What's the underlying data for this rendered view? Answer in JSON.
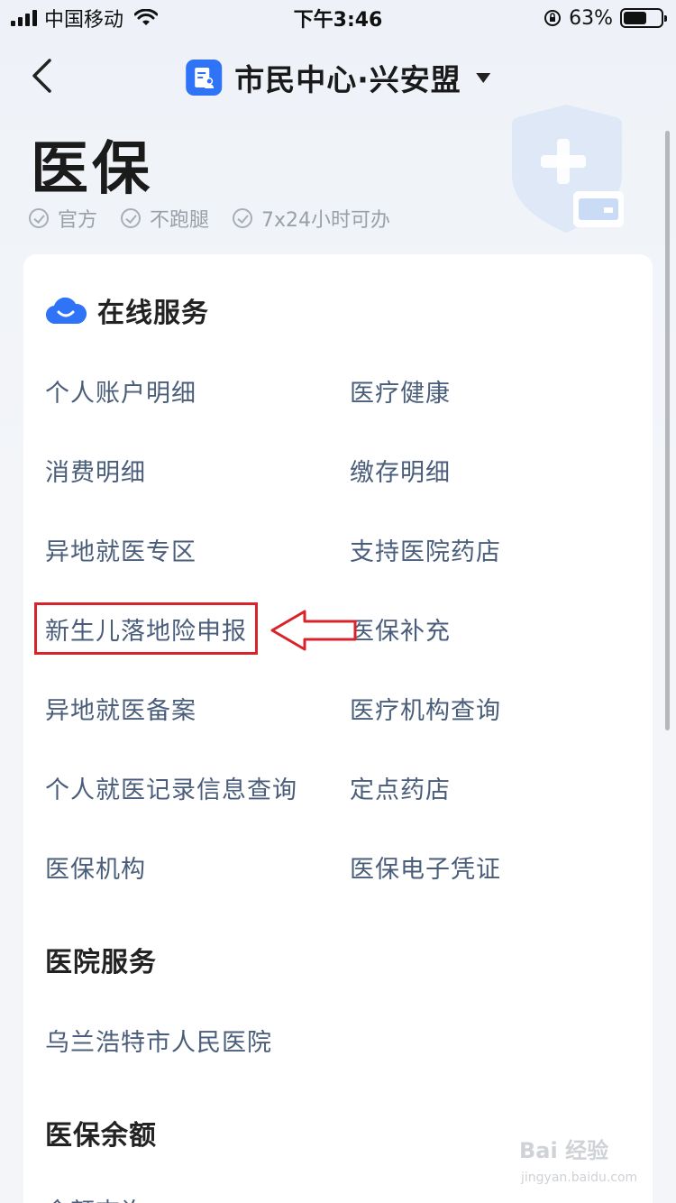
{
  "status_bar": {
    "carrier": "中国移动",
    "time": "下午3:46",
    "battery": "63%"
  },
  "nav": {
    "title": "市民中心·兴安盟"
  },
  "header": {
    "title": "医保",
    "tags": [
      "官方",
      "不跑腿",
      "7x24小时可办"
    ]
  },
  "online_services": {
    "title": "在线服务",
    "items": [
      "个人账户明细",
      "医疗健康",
      "消费明细",
      "缴存明细",
      "异地就医专区",
      "支持医院药店",
      "新生儿落地险申报",
      "医保补充",
      "异地就医备案",
      "医疗机构查询",
      "个人就医记录信息查询",
      "定点药店",
      "医保机构",
      "医保电子凭证"
    ]
  },
  "hospital_services": {
    "title": "医院服务",
    "items": [
      "乌兰浩特市人民医院"
    ]
  },
  "balance": {
    "title": "医保余额",
    "items": [
      "余额查询"
    ]
  },
  "watermark": {
    "main": "Bai 经验",
    "sub": "jingyan.baidu.com"
  },
  "colors": {
    "accent": "#2f73f6",
    "link_text": "#4a5d7a",
    "annotation_red": "#d8232a"
  }
}
